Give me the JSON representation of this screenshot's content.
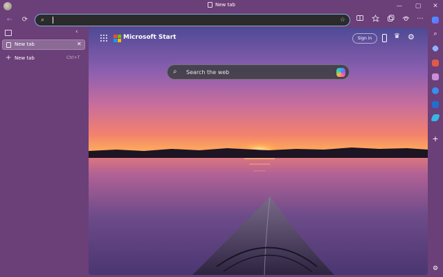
{
  "window": {
    "title": "New tab"
  },
  "titlebar": {
    "minimize": "—",
    "maximize": "▢",
    "close": "✕"
  },
  "toolbar": {
    "back": "←",
    "refresh": "⟳",
    "search_glyph": "⌕",
    "address_value": "",
    "address_placeholder": "",
    "favorite": "☆",
    "icons": [
      "split-screen-icon",
      "favorites-icon",
      "collections-icon",
      "browser-essentials-icon",
      "more-icon"
    ],
    "more": "···"
  },
  "sidebar": {
    "collapse": "‹",
    "tabs": [
      {
        "label": "New tab",
        "close": "✕"
      }
    ],
    "new_tab": {
      "plus": "+",
      "label": "New tab",
      "shortcut": "Ctrl+T"
    }
  },
  "page": {
    "brand": "Microsoft Start",
    "signin": "Sign in",
    "search_placeholder": "Search the web",
    "search_glyph": "⌕",
    "trophy": "♛",
    "settings": "⚙"
  },
  "rail": {
    "icons": [
      "search-icon",
      "tag-icon",
      "toolbox-icon",
      "games-icon",
      "copilot-icon",
      "outlook-icon",
      "send-icon",
      "add-icon",
      "rail-settings-icon"
    ],
    "plus": "+",
    "search": "⌕",
    "settings": "⚙"
  },
  "colors": {
    "chrome": "#6b3f78",
    "address_border": "#7aaee0",
    "sky_top": "#5b4d99",
    "sky_mid": "#c26aa0",
    "horizon": "#ff9a57",
    "ms_red": "#f25022",
    "ms_green": "#7fba00",
    "ms_blue": "#00a4ef",
    "ms_yellow": "#ffb900"
  }
}
